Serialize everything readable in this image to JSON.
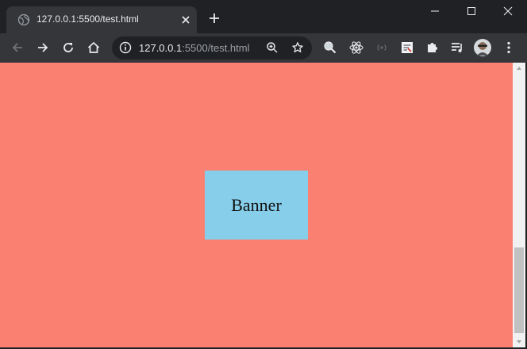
{
  "tab": {
    "title": "127.0.0.1:5500/test.html"
  },
  "omnibox": {
    "host": "127.0.0.1",
    "rest": ":5500/test.html"
  },
  "page": {
    "banner_text": "Banner",
    "background_color": "#fa8072",
    "banner_color": "#87ceeb"
  },
  "icons": {
    "toolbar": [
      "back-icon",
      "forward-icon",
      "reload-icon",
      "home-icon"
    ],
    "extensions": [
      "magnifier-icon",
      "react-icon",
      "broadcast-icon",
      "note-icon",
      "puzzle-icon",
      "playlist-icon",
      "avatar",
      "kebab-menu-icon"
    ]
  }
}
